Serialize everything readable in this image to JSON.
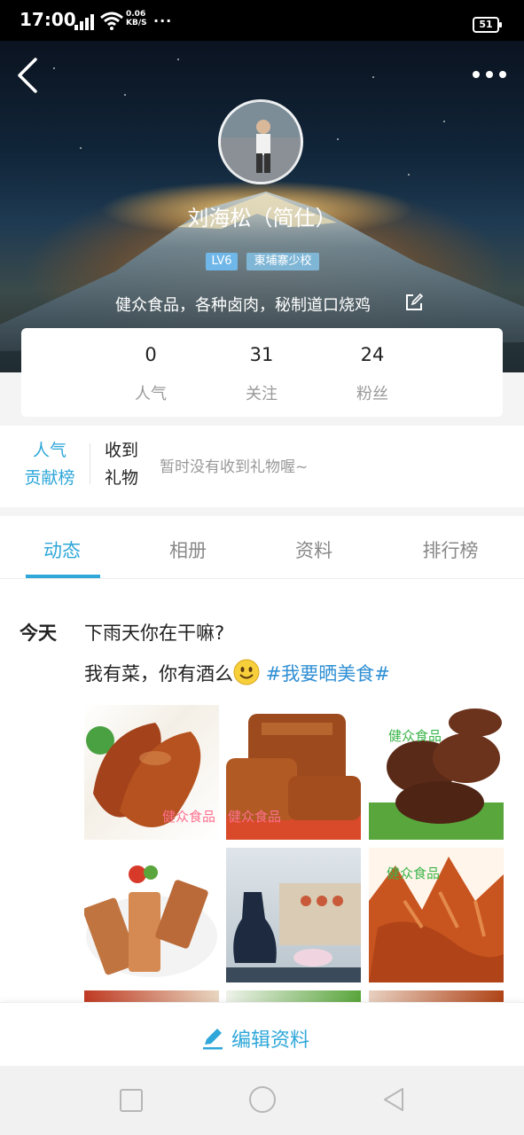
{
  "status_bar": {
    "time": "17:00",
    "net_speed_value": "0.06",
    "net_speed_unit": "KB/S",
    "more": "···",
    "battery": "51"
  },
  "profile": {
    "name": "刘海松（简仕）",
    "level": "LV6",
    "school": "東埔寨少校",
    "bio": "健众食品，各种卤肉，秘制道口烧鸡"
  },
  "stats": [
    {
      "value": "0",
      "label": "人气"
    },
    {
      "value": "31",
      "label": "关注"
    },
    {
      "value": "24",
      "label": "粉丝"
    }
  ],
  "gift": {
    "rank_label_1": "人气",
    "rank_label_2": "贡献榜",
    "received_label_1": "收到",
    "received_label_2": "礼物",
    "empty_text": "暂时没有收到礼物喔~"
  },
  "tabs": [
    {
      "label": "动态",
      "active": true
    },
    {
      "label": "相册",
      "active": false
    },
    {
      "label": "资料",
      "active": false
    },
    {
      "label": "排行榜",
      "active": false
    }
  ],
  "post": {
    "day": "今天",
    "line1": "下雨天你在干嘛?",
    "line2": "我有菜，你有酒么",
    "hashtag": "#我要晒美食#",
    "watermark": "健众食品"
  },
  "bottom": {
    "edit_profile": "编辑资料"
  },
  "colors": {
    "accent": "#2fa7d9",
    "hashtag": "#2f8fd4",
    "watermark_pink": "#ff6f8e",
    "watermark_green": "#3bb54a"
  }
}
